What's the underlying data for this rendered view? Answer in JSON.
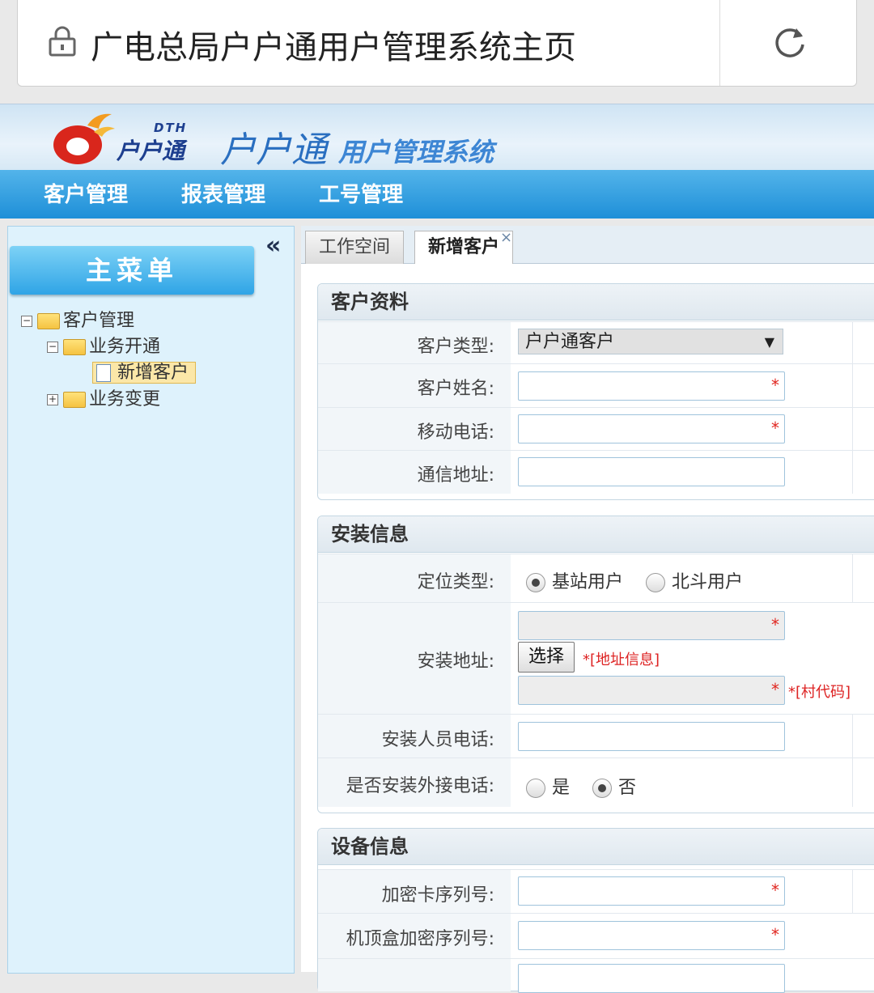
{
  "browser": {
    "title": "广电总局户户通用户管理系统主页"
  },
  "banner": {
    "logo_small": "户户通",
    "logo_dth": "DTH",
    "logo_big": "户户通",
    "logo_sub": "用户管理系统"
  },
  "nav": {
    "items": [
      "客户管理",
      "报表管理",
      "工号管理"
    ]
  },
  "sidebar": {
    "collapse": "«",
    "menu_title": "主菜单",
    "tree": {
      "root": "客户管理",
      "group1": "业务开通",
      "leaf1": "新增客户",
      "group2": "业务变更"
    }
  },
  "tabs": {
    "workspace": "工作空间",
    "new_customer": "新增客户",
    "close": "×"
  },
  "customer_info": {
    "title": "客户资料",
    "type_label": "客户类型:",
    "type_value": "户户通客户",
    "name_label": "客户姓名:",
    "mobile_label": "移动电话:",
    "address_label": "通信地址:"
  },
  "install_info": {
    "title": "安装信息",
    "locate_label": "定位类型:",
    "locate_opt1": "基站用户",
    "locate_opt2": "北斗用户",
    "addr_label": "安装地址:",
    "choose_btn": "选择",
    "addr_hint": "*[地址信息]",
    "village_hint": "*[村代码]",
    "installer_phone_label": "安装人员电话:",
    "ext_phone_label": "是否安装外接电话:",
    "ext_yes": "是",
    "ext_no": "否"
  },
  "device_info": {
    "title": "设备信息",
    "card_label": "加密卡序列号:",
    "stb_label": "机顶盒加密序列号:"
  },
  "required_mark": "*",
  "colors": {
    "nav": "#1e8fd8",
    "required": "#e0261f",
    "panel_border": "#c4d6e2"
  }
}
